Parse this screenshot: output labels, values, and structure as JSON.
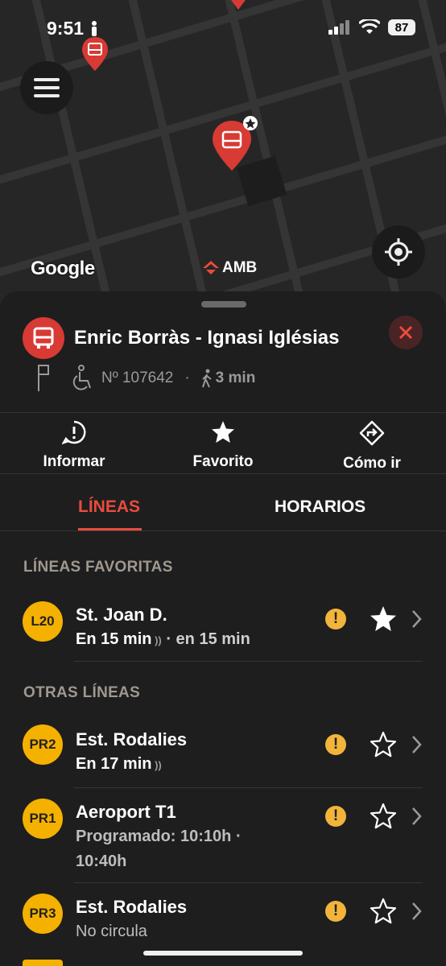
{
  "status_bar": {
    "time": "9:51",
    "battery": "87"
  },
  "map": {
    "google_label": "Google",
    "amb_label": "AMB"
  },
  "stop": {
    "name": "Enric Borràs - Ignasi Iglésias",
    "number": "Nº 107642",
    "separator": "·",
    "walk_time": "3 min"
  },
  "actions": {
    "report": "Informar",
    "favorite": "Favorito",
    "directions": "Cómo ir"
  },
  "tabs": {
    "lines": "LÍNEAS",
    "schedules": "HORARIOS"
  },
  "sections": {
    "favorites": "LÍNEAS FAVORITAS",
    "others": "OTRAS LÍNEAS"
  },
  "favorite_lines": [
    {
      "code": "L20",
      "destination": "St. Joan D.",
      "arrival": "En 15 min",
      "next": "· en 15 min",
      "favorited": true
    }
  ],
  "other_lines": [
    {
      "code": "PR2",
      "destination": "Est. Rodalies",
      "arrival": "En 17 min",
      "favorited": false
    },
    {
      "code": "PR1",
      "destination": "Aeroport T1",
      "arrival_line1": "Programado: 10:10h ·",
      "arrival_line2": "10:40h",
      "favorited": false
    },
    {
      "code": "PR3",
      "destination": "Est. Rodalies",
      "status": "No circula",
      "favorited": false
    }
  ],
  "colors": {
    "accent": "#e84c3d",
    "badge": "#f5b100",
    "alert": "#f2b43a",
    "marker": "#d83a34"
  }
}
